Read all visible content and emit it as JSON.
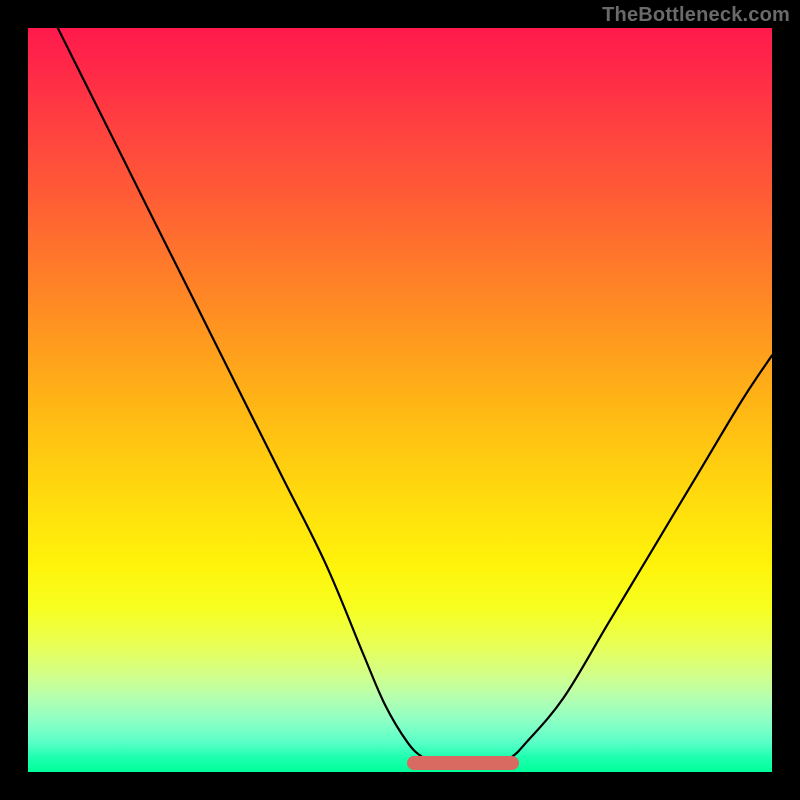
{
  "watermark": "TheBottleneck.com",
  "chart_data": {
    "type": "line",
    "title": "",
    "xlabel": "",
    "ylabel": "",
    "xlim": [
      0,
      100
    ],
    "ylim": [
      0,
      100
    ],
    "grid": false,
    "series": [
      {
        "name": "bottleneck-curve",
        "color": "#000000",
        "x": [
          4,
          10,
          16,
          22,
          28,
          34,
          40,
          45,
          48,
          51,
          53,
          55,
          57,
          60,
          63,
          65,
          67,
          72,
          78,
          84,
          90,
          96,
          100
        ],
        "y": [
          100,
          88,
          76,
          64,
          52,
          40,
          28,
          16,
          9,
          4,
          2,
          1,
          1,
          1,
          1,
          2,
          4,
          10,
          20,
          30,
          40,
          50,
          56
        ]
      }
    ],
    "annotations": [
      {
        "name": "optimal-range-marker",
        "x_start": 51,
        "x_end": 66,
        "y": 1,
        "color": "#d86a62"
      }
    ],
    "background_gradient": {
      "direction": "vertical",
      "stops": [
        {
          "pos": 0.0,
          "color": "#ff1a4d"
        },
        {
          "pos": 0.5,
          "color": "#ffc010"
        },
        {
          "pos": 0.75,
          "color": "#fff30a"
        },
        {
          "pos": 1.0,
          "color": "#00ff99"
        }
      ]
    }
  }
}
